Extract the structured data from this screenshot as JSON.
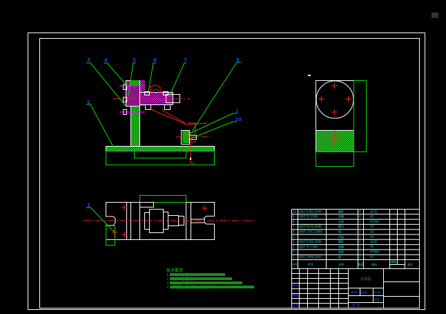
{
  "drawing": {
    "colors": {
      "background": "#000000",
      "outline": "#ffffff",
      "hatch": "#00e000",
      "centerline": "#ff2020",
      "leader": "#00e000",
      "label": "#2040ff",
      "table_text": "#00d8d8"
    },
    "part_labels": [
      "3",
      "4",
      "5",
      "6",
      "7",
      "8",
      "1",
      "10",
      "2"
    ],
    "plan_label": "1",
    "side_label": "A",
    "notes": {
      "title": "技术要求",
      "items": [
        "1.  未注表面粗糙度Ra1.6",
        "2.  配合表面粗糙度Ra12.5",
        "3.  定位面平行度0.01",
        "4.  装配后各活动部位应灵活可靠"
      ]
    },
    "parts_list": {
      "rows": [
        {
          "no": "10",
          "code": "GB/T 5783-2000",
          "name": "螺栓",
          "qty": "4",
          "material": "Q235"
        },
        {
          "no": "9",
          "code": "GB/T 97-1985",
          "name": "垫圈",
          "qty": "4",
          "material": "45"
        },
        {
          "no": "8",
          "code": "",
          "name": "支架",
          "qty": "1",
          "material": "HT200"
        },
        {
          "no": "7",
          "code": "GB/T 6170-2000",
          "name": "螺母",
          "qty": "1",
          "material": "45"
        },
        {
          "no": "6",
          "code": "GB/T 119.1-2000",
          "name": "销",
          "qty": "2",
          "material": "35"
        },
        {
          "no": "5",
          "code": "",
          "name": "压板",
          "qty": "1",
          "material": "45"
        },
        {
          "no": "4",
          "code": "GB/T 5782-2000",
          "name": "螺栓",
          "qty": "2",
          "material": "Q235"
        },
        {
          "no": "3",
          "code": "GB/T 97-1985",
          "name": "垫圈",
          "qty": "1",
          "material": "45"
        },
        {
          "no": "2",
          "code": "",
          "name": "底座",
          "qty": "1",
          "material": "HT200"
        },
        {
          "no": "1",
          "code": "GB/T 1096-2003",
          "name": "键",
          "qty": "2",
          "material": "45"
        }
      ],
      "header": {
        "no": "序号",
        "code": "代号",
        "name": "名称",
        "qty": "数量",
        "material": "材料",
        "weight": "重量",
        "remark": "备注"
      }
    },
    "title_block": {
      "title": "夹具图",
      "scale": "1:1",
      "scale_label": "比例",
      "sheet": "共 张",
      "designer": "设计",
      "checker": "审核",
      "approver": "批准",
      "school": "学校",
      "class": "班级"
    }
  }
}
